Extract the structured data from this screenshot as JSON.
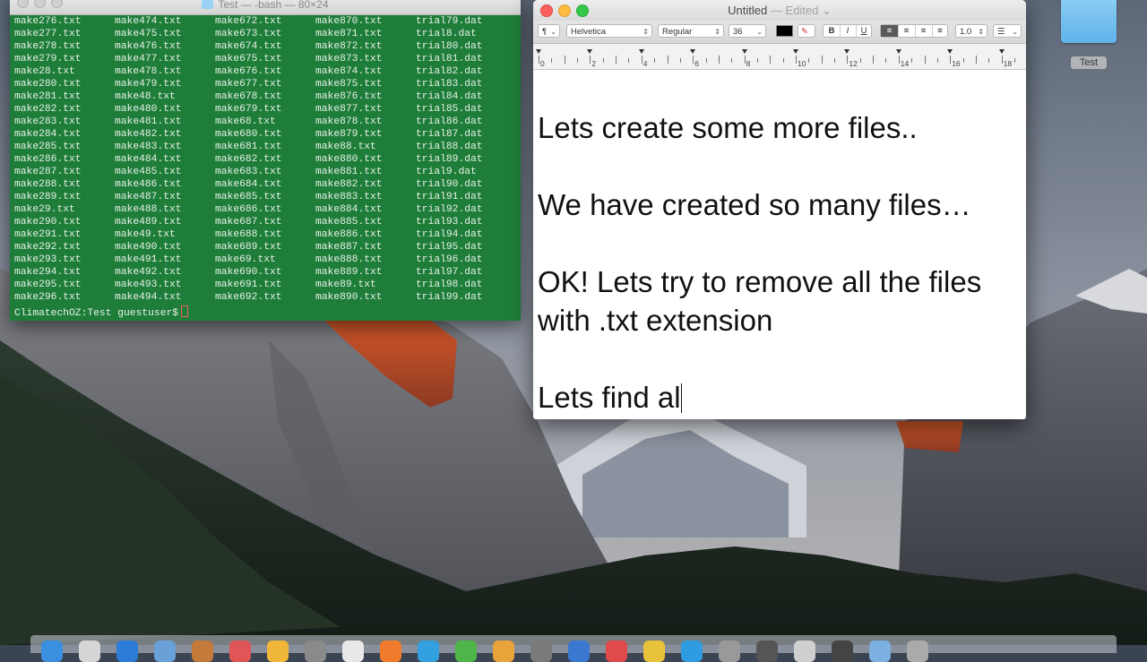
{
  "desktop": {
    "folder_label": "Test"
  },
  "terminal": {
    "title": "Test — -bash — 80×24",
    "rows": [
      [
        "make276.txt",
        "make474.txt",
        "make672.txt",
        "make870.txt",
        "trial79.dat"
      ],
      [
        "make277.txt",
        "make475.txt",
        "make673.txt",
        "make871.txt",
        "trial8.dat"
      ],
      [
        "make278.txt",
        "make476.txt",
        "make674.txt",
        "make872.txt",
        "trial80.dat"
      ],
      [
        "make279.txt",
        "make477.txt",
        "make675.txt",
        "make873.txt",
        "trial81.dat"
      ],
      [
        "make28.txt",
        "make478.txt",
        "make676.txt",
        "make874.txt",
        "trial82.dat"
      ],
      [
        "make280.txt",
        "make479.txt",
        "make677.txt",
        "make875.txt",
        "trial83.dat"
      ],
      [
        "make281.txt",
        "make48.txt",
        "make678.txt",
        "make876.txt",
        "trial84.dat"
      ],
      [
        "make282.txt",
        "make480.txt",
        "make679.txt",
        "make877.txt",
        "trial85.dat"
      ],
      [
        "make283.txt",
        "make481.txt",
        "make68.txt",
        "make878.txt",
        "trial86.dat"
      ],
      [
        "make284.txt",
        "make482.txt",
        "make680.txt",
        "make879.txt",
        "trial87.dat"
      ],
      [
        "make285.txt",
        "make483.txt",
        "make681.txt",
        "make88.txt",
        "trial88.dat"
      ],
      [
        "make286.txt",
        "make484.txt",
        "make682.txt",
        "make880.txt",
        "trial89.dat"
      ],
      [
        "make287.txt",
        "make485.txt",
        "make683.txt",
        "make881.txt",
        "trial9.dat"
      ],
      [
        "make288.txt",
        "make486.txt",
        "make684.txt",
        "make882.txt",
        "trial90.dat"
      ],
      [
        "make289.txt",
        "make487.txt",
        "make685.txt",
        "make883.txt",
        "trial91.dat"
      ],
      [
        "make29.txt",
        "make488.txt",
        "make686.txt",
        "make884.txt",
        "trial92.dat"
      ],
      [
        "make290.txt",
        "make489.txt",
        "make687.txt",
        "make885.txt",
        "trial93.dat"
      ],
      [
        "make291.txt",
        "make49.txt",
        "make688.txt",
        "make886.txt",
        "trial94.dat"
      ],
      [
        "make292.txt",
        "make490.txt",
        "make689.txt",
        "make887.txt",
        "trial95.dat"
      ],
      [
        "make293.txt",
        "make491.txt",
        "make69.txt",
        "make888.txt",
        "trial96.dat"
      ],
      [
        "make294.txt",
        "make492.txt",
        "make690.txt",
        "make889.txt",
        "trial97.dat"
      ],
      [
        "make295.txt",
        "make493.txt",
        "make691.txt",
        "make89.txt",
        "trial98.dat"
      ],
      [
        "make296.txt",
        "make494.txt",
        "make692.txt",
        "make890.txt",
        "trial99.dat"
      ]
    ],
    "prompt": "ClimatechOZ:Test guestuser$"
  },
  "textedit": {
    "title": "Untitled",
    "title_status": "— Edited",
    "toolbar": {
      "paragraph_style": "¶",
      "font_family": "Helvetica",
      "font_style": "Regular",
      "font_size": "36",
      "bold": "B",
      "italic": "I",
      "underline": "U",
      "line_spacing": "1.0"
    },
    "ruler_numbers": [
      "0",
      "2",
      "4",
      "6",
      "8",
      "10",
      "12",
      "14",
      "16",
      "18"
    ],
    "document": {
      "p1": "Lets create some more files..",
      "p2": "We have created so many files…",
      "p3": "OK! Lets try to remove all the files with .txt extension",
      "p4": "Lets find al"
    }
  },
  "colors": {
    "terminal_background": "#1f7d3a",
    "terminal_text": "#e6f2e6",
    "close_button": "#fc605c",
    "minimize_button": "#fdbc40",
    "zoom_button": "#34c84a",
    "folder_blue": "#5fb2e8"
  },
  "icons": {
    "desktop_folder": "folder-icon",
    "terminal_title_folder": "folder-icon",
    "text_color_well": "color-swatch-icon",
    "highlight": "highlighter-icon",
    "align_left": "align-left-icon",
    "align_center": "align-center-icon",
    "align_right": "align-right-icon",
    "align_justify": "align-justify-icon",
    "list": "list-bullets-icon"
  }
}
